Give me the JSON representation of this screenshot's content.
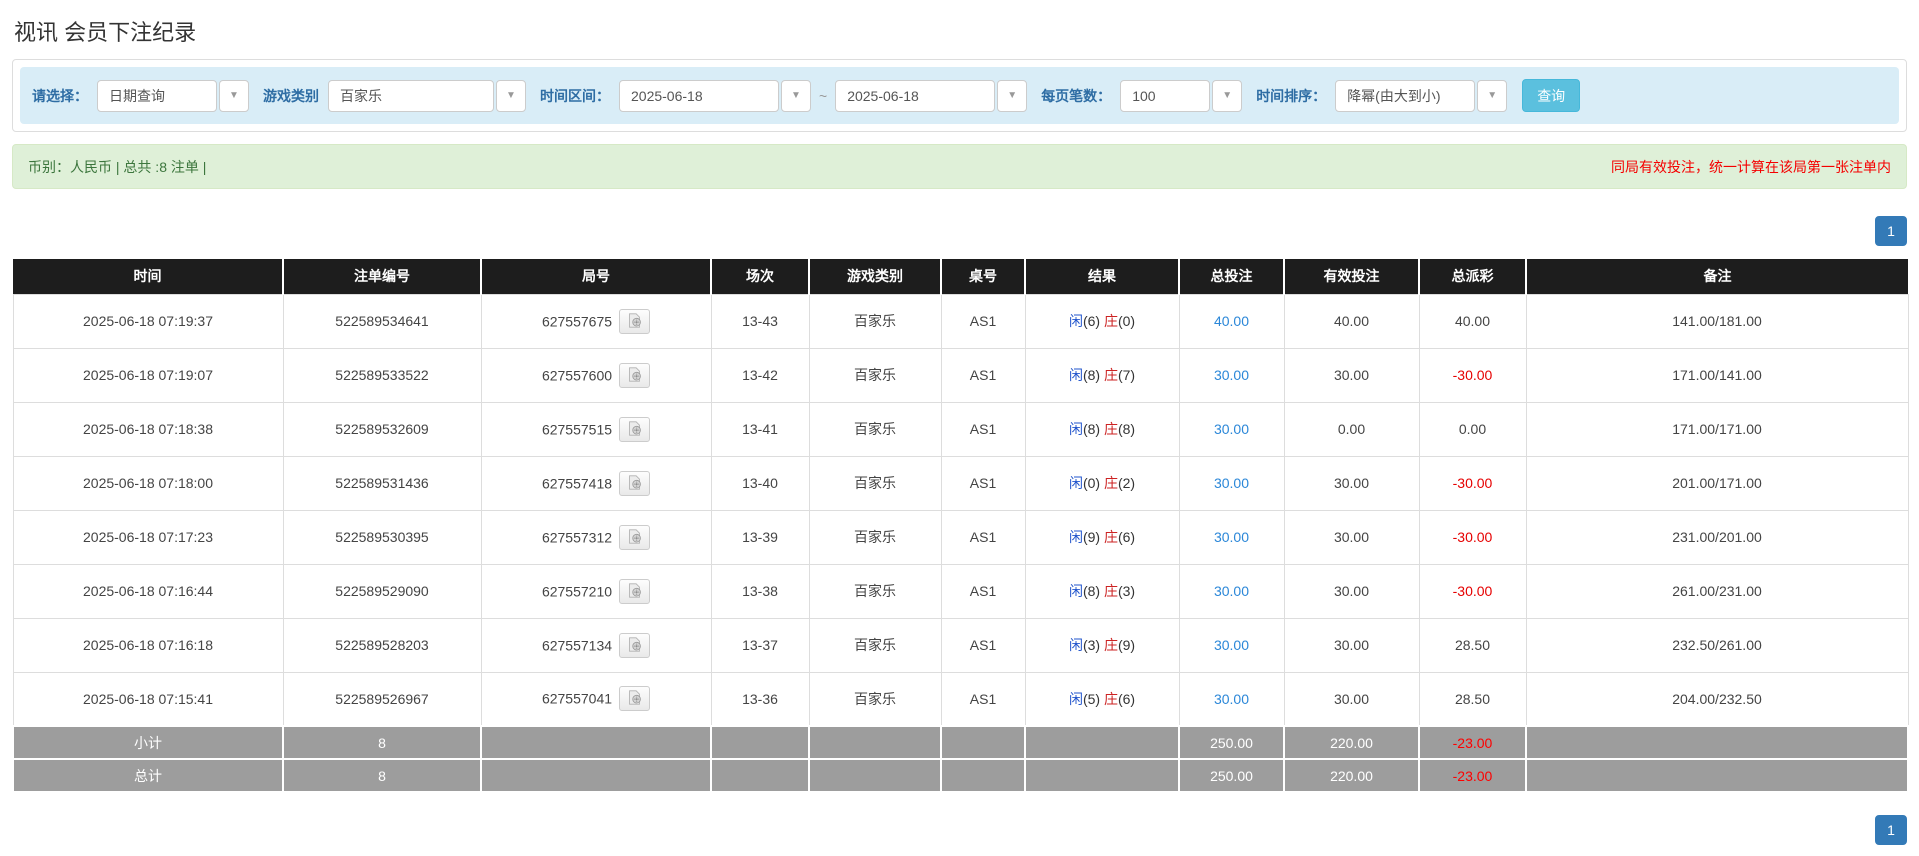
{
  "page_title": "视讯 会员下注纪录",
  "filters": {
    "select_label": "请选择：",
    "select_value": "日期查询",
    "game_type_label": "游戏类别",
    "game_type_value": "百家乐",
    "time_range_label": "时间区间：",
    "date_from": "2025-06-18",
    "range_separator": "~",
    "date_to": "2025-06-18",
    "page_size_label": "每页笔数：",
    "page_size_value": "100",
    "sort_label": "时间排序：",
    "sort_value": "降幂(由大到小)",
    "search_button": "查询"
  },
  "summary": {
    "left_text": "币别：人民币 | 总共 :8 注单 |",
    "right_notice": "同局有效投注，统一计算在该局第一张注单内"
  },
  "pagination": {
    "current_page": "1"
  },
  "icons": {
    "caret_glyph": "▼",
    "video_button_icon": "film-icon"
  },
  "colors": {
    "filter_bg": "#d9edf7",
    "label_blue": "#2e6da4",
    "search_btn": "#5bc0de",
    "summary_bg": "#dff0d8",
    "summary_text": "#3c763d",
    "notice_red": "#f50000",
    "header_bg": "#1d1d1d",
    "summary_row_bg": "#9d9d9d",
    "pagination_blue": "#337ab7",
    "link_blue": "#2b87d8",
    "player_blue": "#2255cc",
    "banker_red": "#cc2222",
    "negative_red": "#e60000"
  },
  "table": {
    "headers": [
      "时间",
      "注单编号",
      "局号",
      "场次",
      "游戏类别",
      "桌号",
      "结果",
      "总投注",
      "有效投注",
      "总派彩",
      "备注"
    ],
    "rows": [
      {
        "time": "2025-06-18 07:19:37",
        "bet_id": "522589534641",
        "round_id": "627557675",
        "session": "13-43",
        "game_type": "百家乐",
        "table_no": "AS1",
        "player": "闲",
        "player_score": "(6)",
        "banker": "庄",
        "banker_score": "(0)",
        "total_bet": "40.00",
        "valid_bet": "40.00",
        "payout": "40.00",
        "remark": "141.00/181.00"
      },
      {
        "time": "2025-06-18 07:19:07",
        "bet_id": "522589533522",
        "round_id": "627557600",
        "session": "13-42",
        "game_type": "百家乐",
        "table_no": "AS1",
        "player": "闲",
        "player_score": "(8)",
        "banker": "庄",
        "banker_score": "(7)",
        "total_bet": "30.00",
        "valid_bet": "30.00",
        "payout": "-30.00",
        "remark": "171.00/141.00"
      },
      {
        "time": "2025-06-18 07:18:38",
        "bet_id": "522589532609",
        "round_id": "627557515",
        "session": "13-41",
        "game_type": "百家乐",
        "table_no": "AS1",
        "player": "闲",
        "player_score": "(8)",
        "banker": "庄",
        "banker_score": "(8)",
        "total_bet": "30.00",
        "valid_bet": "0.00",
        "payout": "0.00",
        "remark": "171.00/171.00"
      },
      {
        "time": "2025-06-18 07:18:00",
        "bet_id": "522589531436",
        "round_id": "627557418",
        "session": "13-40",
        "game_type": "百家乐",
        "table_no": "AS1",
        "player": "闲",
        "player_score": "(0)",
        "banker": "庄",
        "banker_score": "(2)",
        "total_bet": "30.00",
        "valid_bet": "30.00",
        "payout": "-30.00",
        "remark": "201.00/171.00"
      },
      {
        "time": "2025-06-18 07:17:23",
        "bet_id": "522589530395",
        "round_id": "627557312",
        "session": "13-39",
        "game_type": "百家乐",
        "table_no": "AS1",
        "player": "闲",
        "player_score": "(9)",
        "banker": "庄",
        "banker_score": "(6)",
        "total_bet": "30.00",
        "valid_bet": "30.00",
        "payout": "-30.00",
        "remark": "231.00/201.00"
      },
      {
        "time": "2025-06-18 07:16:44",
        "bet_id": "522589529090",
        "round_id": "627557210",
        "session": "13-38",
        "game_type": "百家乐",
        "table_no": "AS1",
        "player": "闲",
        "player_score": "(8)",
        "banker": "庄",
        "banker_score": "(3)",
        "total_bet": "30.00",
        "valid_bet": "30.00",
        "payout": "-30.00",
        "remark": "261.00/231.00"
      },
      {
        "time": "2025-06-18 07:16:18",
        "bet_id": "522589528203",
        "round_id": "627557134",
        "session": "13-37",
        "game_type": "百家乐",
        "table_no": "AS1",
        "player": "闲",
        "player_score": "(3)",
        "banker": "庄",
        "banker_score": "(9)",
        "total_bet": "30.00",
        "valid_bet": "30.00",
        "payout": "28.50",
        "remark": "232.50/261.00"
      },
      {
        "time": "2025-06-18 07:15:41",
        "bet_id": "522589526967",
        "round_id": "627557041",
        "session": "13-36",
        "game_type": "百家乐",
        "table_no": "AS1",
        "player": "闲",
        "player_score": "(5)",
        "banker": "庄",
        "banker_score": "(6)",
        "total_bet": "30.00",
        "valid_bet": "30.00",
        "payout": "28.50",
        "remark": "204.00/232.50"
      }
    ],
    "subtotal": {
      "label": "小计",
      "count": "8",
      "total_bet": "250.00",
      "valid_bet": "220.00",
      "payout": "-23.00"
    },
    "total": {
      "label": "总计",
      "count": "8",
      "total_bet": "250.00",
      "valid_bet": "220.00",
      "payout": "-23.00"
    }
  }
}
